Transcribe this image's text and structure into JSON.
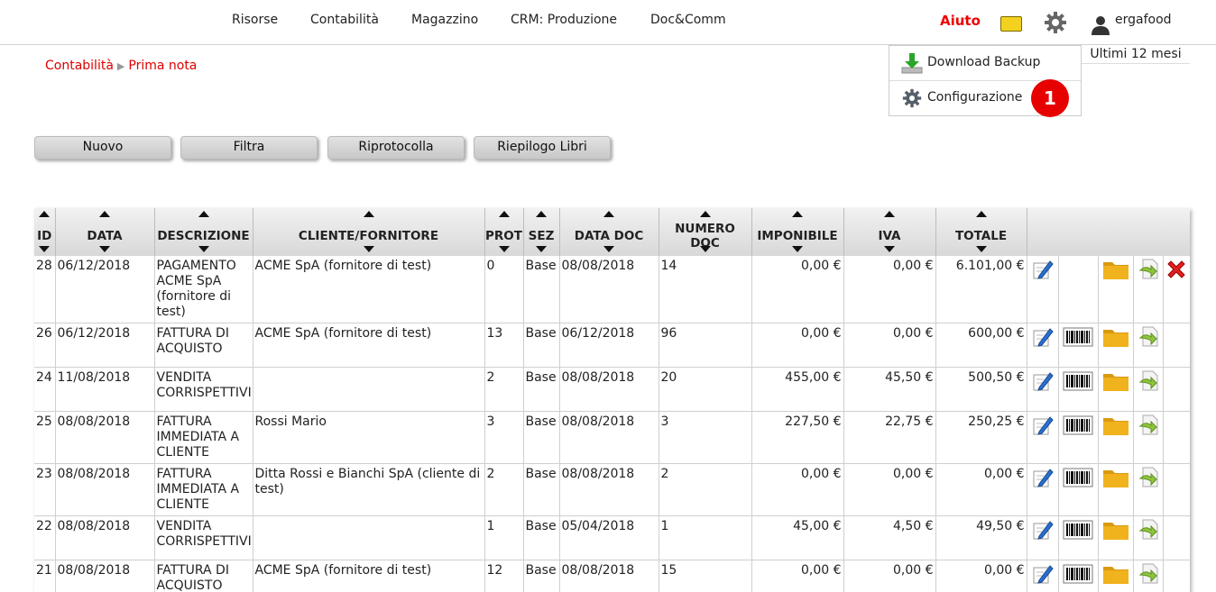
{
  "topnav": {
    "items": [
      "Risorse",
      "Contabilità",
      "Magazzino",
      "CRM: Produzione",
      "Doc&Comm"
    ],
    "help": "Aiuto",
    "user": "ergafood"
  },
  "breadcrumb": {
    "section": "Contabilità",
    "page": "Prima nota"
  },
  "period": "Ultimi 12 mesi",
  "dropdown": {
    "backup": "Download Backup",
    "config": "Configurazione",
    "badge": "1"
  },
  "toolbar": {
    "new": "Nuovo",
    "filter": "Filtra",
    "renumber": "Riprotocolla",
    "summary": "Riepilogo Libri"
  },
  "table": {
    "headers": [
      "ID",
      "DATA",
      "DESCRIZIONE",
      "CLIENTE/FORNITORE",
      "PROT",
      "SEZ",
      "DATA DOC",
      "NUMERO DOC",
      "IMPONIBILE",
      "IVA",
      "TOTALE"
    ],
    "rows": [
      [
        "28",
        "06/12/2018",
        "PAGAMENTO ACME SpA (fornitore di test)",
        "ACME SpA (fornitore di test)",
        "0",
        "Base",
        "08/08/2018",
        "14",
        "0,00 €",
        "0,00 €",
        "6.101,00 €"
      ],
      [
        "26",
        "06/12/2018",
        "FATTURA DI ACQUISTO",
        "ACME SpA (fornitore di test)",
        "13",
        "Base",
        "06/12/2018",
        "96",
        "0,00 €",
        "0,00 €",
        "600,00 €"
      ],
      [
        "24",
        "11/08/2018",
        "VENDITA CORRISPETTIVI",
        "",
        "2",
        "Base",
        "08/08/2018",
        "20",
        "455,00 €",
        "45,50 €",
        "500,50 €"
      ],
      [
        "25",
        "08/08/2018",
        "FATTURA IMMEDIATA A CLIENTE",
        "Rossi Mario",
        "3",
        "Base",
        "08/08/2018",
        "3",
        "227,50 €",
        "22,75 €",
        "250,25 €"
      ],
      [
        "23",
        "08/08/2018",
        "FATTURA IMMEDIATA A CLIENTE",
        "Ditta Rossi e Bianchi SpA (cliente di test)",
        "2",
        "Base",
        "08/08/2018",
        "2",
        "0,00 €",
        "0,00 €",
        "0,00 €"
      ],
      [
        "22",
        "08/08/2018",
        "VENDITA CORRISPETTIVI",
        "",
        "1",
        "Base",
        "05/04/2018",
        "1",
        "45,00 €",
        "4,50 €",
        "49,50 €"
      ],
      [
        "21",
        "08/08/2018",
        "FATTURA DI ACQUISTO",
        "ACME SpA (fornitore di test)",
        "12",
        "Base",
        "08/08/2018",
        "15",
        "0,00 €",
        "0,00 €",
        "0,00 €"
      ]
    ],
    "row_icons": [
      [
        "edit-icon",
        "",
        "folder-icon",
        "export-icon",
        "delete-icon"
      ],
      [
        "edit-icon",
        "barcode-icon",
        "folder-icon",
        "export-icon",
        ""
      ],
      [
        "edit-icon",
        "barcode-icon",
        "folder-icon",
        "export-icon",
        ""
      ],
      [
        "edit-icon",
        "barcode-icon",
        "folder-icon",
        "export-icon",
        ""
      ],
      [
        "edit-icon",
        "barcode-icon",
        "folder-icon",
        "export-icon",
        ""
      ],
      [
        "edit-icon",
        "barcode-icon",
        "folder-icon",
        "export-icon",
        ""
      ],
      [
        "edit-icon",
        "barcode-icon",
        "folder-icon",
        "export-icon",
        ""
      ]
    ]
  },
  "colors": {
    "accent": "#dd0000",
    "badge": "#e60000",
    "folder": "#f0b21d"
  }
}
